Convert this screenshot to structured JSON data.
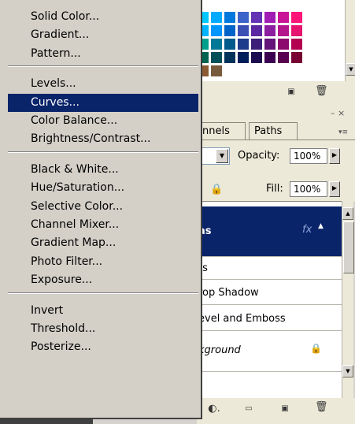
{
  "menu": {
    "groups": [
      [
        "Solid Color...",
        "Gradient...",
        "Pattern..."
      ],
      [
        "Levels...",
        "Curves...",
        "Color Balance...",
        "Brightness/Contrast..."
      ],
      [
        "Black & White...",
        "Hue/Saturation...",
        "Selective Color...",
        "Channel Mixer...",
        "Gradient Map...",
        "Photo Filter...",
        "Exposure..."
      ],
      [
        "Invert",
        "Threshold...",
        "Posterize..."
      ]
    ],
    "items": [
      {
        "label": "Solid Color..."
      },
      {
        "label": "Gradient..."
      },
      {
        "label": "Pattern..."
      },
      {
        "label": "Levels..."
      },
      {
        "label": "Curves...",
        "selected": true
      },
      {
        "label": "Color Balance..."
      },
      {
        "label": "Brightness/Contrast..."
      },
      {
        "label": "Black & White..."
      },
      {
        "label": "Hue/Saturation..."
      },
      {
        "label": "Selective Color..."
      },
      {
        "label": "Channel Mixer..."
      },
      {
        "label": "Gradient Map..."
      },
      {
        "label": "Photo Filter..."
      },
      {
        "label": "Exposure..."
      },
      {
        "label": "Invert"
      },
      {
        "label": "Threshold..."
      },
      {
        "label": "Posterize..."
      }
    ],
    "selected_color": "#0a246a"
  },
  "layers_panel": {
    "tabs": [
      {
        "label": "nnels"
      },
      {
        "label": "Paths"
      }
    ],
    "opacity_label": "Opacity:",
    "opacity_value": "100%",
    "fill_label": "Fill:",
    "fill_value": "100%",
    "layers": [
      {
        "label": "as",
        "selected": true
      },
      {
        "label": "ts"
      },
      {
        "label": "rop Shadow"
      },
      {
        "label": "evel and Emboss"
      },
      {
        "label": "kground"
      }
    ],
    "selected_color": "#0a246a"
  },
  "swatches": {
    "rows": [
      [
        "#00b4ff",
        "#0096ff",
        "#0064c8",
        "#3c50b4",
        "#5a28a0",
        "#8c1ea0",
        "#b4148c",
        "#e6146e"
      ],
      [
        "#00a08c",
        "#007896",
        "#005a8c",
        "#1e3c8c",
        "#3c1e78",
        "#641478",
        "#8c0a6e",
        "#b40050"
      ],
      [
        "#006450",
        "#00505a",
        "#00325a",
        "#001e5a",
        "#1e0a50",
        "#3c0050",
        "#5a0050",
        "#780032"
      ],
      [
        "#8c5a32",
        "#785a3c",
        "#ffffff",
        "#ffffff",
        "#ffffff",
        "#ffffff",
        "#ffffff",
        "#ffffff"
      ]
    ]
  }
}
